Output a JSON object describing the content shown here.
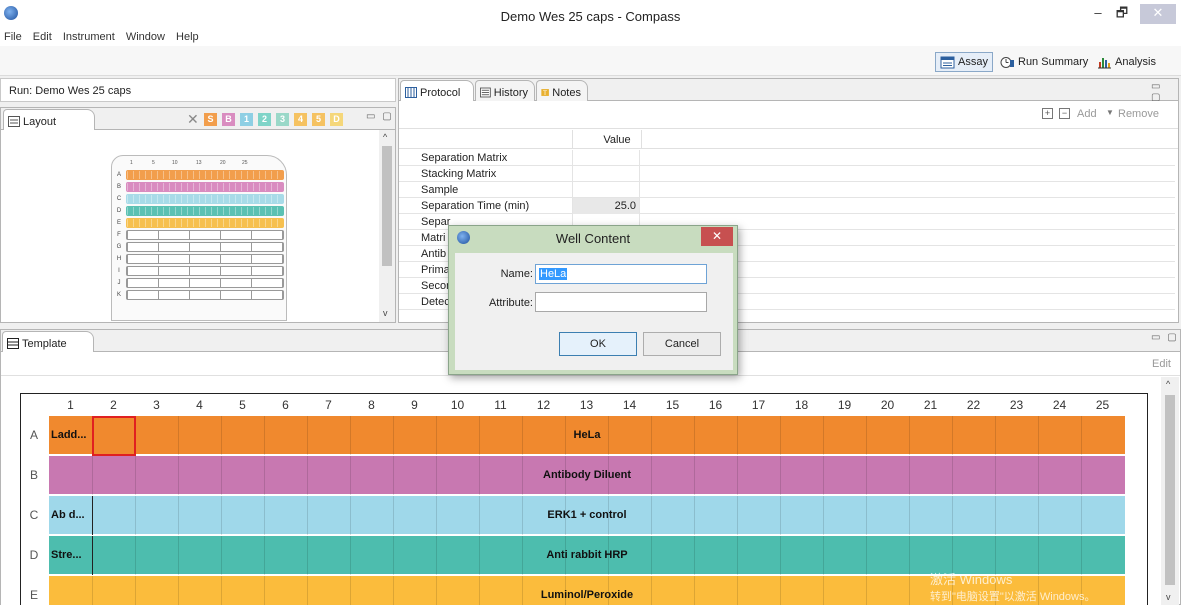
{
  "window": {
    "title": "Demo Wes 25 caps - Compass",
    "minimize": "–",
    "maximize": "🗗",
    "close": "✕"
  },
  "menu": [
    "File",
    "Edit",
    "Instrument",
    "Window",
    "Help"
  ],
  "perspectives": {
    "assay": "Assay",
    "run_summary": "Run Summary",
    "analysis": "Analysis"
  },
  "run_label": "Run:  Demo Wes 25 caps",
  "layout_tab": {
    "label": "Layout",
    "filters": [
      "S",
      "B",
      "1",
      "2",
      "3",
      "4",
      "5",
      "D"
    ],
    "filter_colors": [
      "#f29e4c",
      "#d98cc0",
      "#8ecfe4",
      "#7fd4c8",
      "#9ad8c8",
      "#f5c261",
      "#f5c261",
      "#f5d77a"
    ],
    "close_x": "✕"
  },
  "plate": {
    "col_labels": [
      "1",
      "5",
      "10",
      "13",
      "20",
      "25"
    ],
    "rows": [
      "A",
      "B",
      "C",
      "D",
      "E",
      "F",
      "G",
      "H",
      "I",
      "J",
      "K"
    ],
    "row_colors": [
      "#f29e4c",
      "#d98cc0",
      "#a8dbe8",
      "#5bc1b3",
      "#f6c04f",
      "#ffffff",
      "#ffffff",
      "#ffffff",
      "#ffffff",
      "#ffffff",
      "#ffffff"
    ]
  },
  "protocol_tabs": [
    "Protocol",
    "History",
    "Notes"
  ],
  "protocol_toolbar": {
    "add": "Add",
    "remove": "Remove"
  },
  "protocol_table": {
    "header_value": "Value",
    "rows": [
      {
        "name": "Separation Matrix",
        "value": ""
      },
      {
        "name": "Stacking Matrix",
        "value": ""
      },
      {
        "name": "Sample",
        "value": ""
      },
      {
        "name": "Separation Time (min)",
        "value": "25.0"
      },
      {
        "name": "Separ",
        "value": ""
      },
      {
        "name": "Matri",
        "value": ""
      },
      {
        "name": "Antib",
        "value": ""
      },
      {
        "name": "Prima",
        "value": ""
      },
      {
        "name": "Secor",
        "value": ""
      },
      {
        "name": "Detec",
        "value": ""
      }
    ]
  },
  "dialog": {
    "title": "Well Content",
    "name_label": "Name:",
    "name_value": "HeLa",
    "attribute_label": "Attribute:",
    "attribute_value": "",
    "ok": "OK",
    "cancel": "Cancel",
    "close": "✕"
  },
  "template_tab": {
    "label": "Template",
    "edit": "Edit"
  },
  "template_grid": {
    "columns": [
      "1",
      "2",
      "3",
      "4",
      "5",
      "6",
      "7",
      "8",
      "9",
      "10",
      "11",
      "12",
      "13",
      "14",
      "15",
      "16",
      "17",
      "18",
      "19",
      "20",
      "21",
      "22",
      "23",
      "24",
      "25"
    ],
    "rows": [
      {
        "id": "A",
        "first_cell": "Ladd...",
        "label": "HeLa",
        "color": "#f0892e"
      },
      {
        "id": "B",
        "first_cell": "",
        "label": "Antibody Diluent",
        "color": "#c878b1"
      },
      {
        "id": "C",
        "first_cell": "Ab d...",
        "label": "ERK1 + control",
        "color": "#9fd8ea"
      },
      {
        "id": "D",
        "first_cell": "Stre...",
        "label": "Anti rabbit HRP",
        "color": "#4dbdae"
      },
      {
        "id": "E",
        "first_cell": "",
        "label": "Luminol/Peroxide",
        "color": "#fbbc3c"
      }
    ]
  },
  "watermark": {
    "line1": "激活 Windows",
    "line2": "转到\"电脑设置\"以激活 Windows。"
  }
}
